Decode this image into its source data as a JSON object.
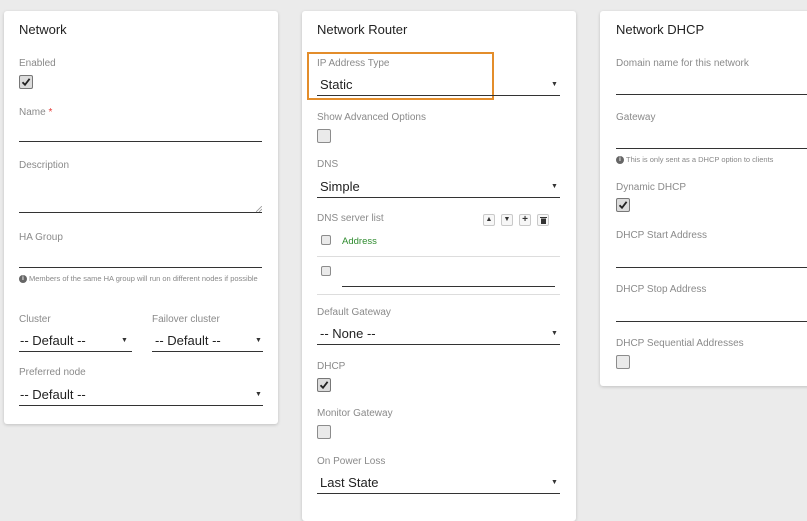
{
  "network": {
    "title": "Network",
    "enabled_label": "Enabled",
    "enabled_checked": true,
    "name_label": "Name",
    "name_required_mark": "*",
    "name_value": "",
    "description_label": "Description",
    "description_value": "",
    "ha_group_label": "HA Group",
    "ha_group_value": "",
    "ha_group_hint": "Members of the same HA group will run on different nodes if possible",
    "cluster_label": "Cluster",
    "cluster_value": "-- Default --",
    "failover_label": "Failover cluster",
    "failover_value": "-- Default --",
    "preferred_node_label": "Preferred node",
    "preferred_node_value": "-- Default --"
  },
  "router": {
    "title": "Network Router",
    "ip_type_label": "IP Address Type",
    "ip_type_value": "Static",
    "show_advanced_label": "Show Advanced Options",
    "show_advanced_checked": false,
    "dns_label": "DNS",
    "dns_value": "Simple",
    "dns_list_label": "DNS server list",
    "dns_list_header": "Address",
    "dns_list_row_value": "",
    "default_gateway_label": "Default Gateway",
    "default_gateway_value": "-- None --",
    "dhcp_label": "DHCP",
    "dhcp_checked": true,
    "monitor_gateway_label": "Monitor Gateway",
    "monitor_gateway_checked": false,
    "power_loss_label": "On Power Loss",
    "power_loss_value": "Last State"
  },
  "dhcp": {
    "title": "Network DHCP",
    "domain_label": "Domain name for this network",
    "domain_value": "",
    "gateway_label": "Gateway",
    "gateway_value": "",
    "gateway_hint": "This is only sent as a DHCP option to clients",
    "dynamic_label": "Dynamic DHCP",
    "dynamic_checked": true,
    "start_label": "DHCP Start Address",
    "start_value": "",
    "stop_label": "DHCP Stop Address",
    "stop_value": "",
    "sequential_label": "DHCP Sequential Addresses",
    "sequential_checked": false
  },
  "icons": {
    "info": "info-icon",
    "caret": "caret-down-icon",
    "check": "checkmark-icon",
    "move_up": "arrow-up-icon",
    "move_down": "arrow-down-icon",
    "add": "plus-icon",
    "delete": "trash-icon"
  },
  "colors": {
    "highlight": "#e38d2b",
    "required": "#e53935",
    "list_header": "#2e8b2e"
  }
}
